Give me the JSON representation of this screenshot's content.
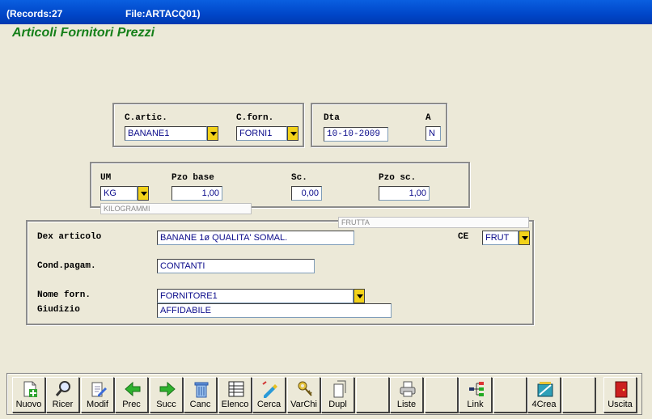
{
  "window": {
    "records": "(Records:27",
    "file": "File:ARTACQ01)"
  },
  "form": {
    "title": "Articoli Fornitori Prezzi",
    "labels": {
      "cartic": "C.artic.",
      "cforn": "C.forn.",
      "dta": "Dta",
      "a": "A",
      "um": "UM",
      "pzo_base": "Pzo base",
      "sc": "Sc.",
      "pzo_sc": "Pzo sc.",
      "dex_articolo": "Dex articolo",
      "ce": "CE",
      "cond_pagam": "Cond.pagam.",
      "nome_forn": "Nome forn.",
      "giudizio": "Giudizio"
    },
    "values": {
      "cartic": "BANANE1",
      "cforn": "FORNI1",
      "dta": "10-10-2009",
      "a": "N",
      "um": "KG",
      "pzo_base": "1,00",
      "sc": "0,00",
      "pzo_sc": "1,00",
      "um_desc": "KILOGRAMMI",
      "frutta": "FRUTTA",
      "dex_articolo": "BANANE 1ø QUALITA' SOMAL.",
      "ce": "FRUT",
      "cond_pagam": "CONTANTI",
      "nome_forn": "FORNITORE1",
      "giudizio": "AFFIDABILE"
    }
  },
  "toolbar": {
    "buttons": [
      {
        "label": "Nuovo",
        "icon": "new-doc-plus-icon"
      },
      {
        "label": "Ricer",
        "icon": "search-magnifier-icon"
      },
      {
        "label": "Modif",
        "icon": "edit-doc-icon"
      },
      {
        "label": "Prec",
        "icon": "arrow-left-icon"
      },
      {
        "label": "Succ",
        "icon": "arrow-right-icon"
      },
      {
        "label": "Canc",
        "icon": "trash-icon"
      },
      {
        "label": "Elenco",
        "icon": "list-table-icon"
      },
      {
        "label": "Cerca",
        "icon": "search-pen-icon"
      },
      {
        "label": "VarChi",
        "icon": "keys-icon"
      },
      {
        "label": "Dupl",
        "icon": "duplicate-icon"
      },
      {
        "label": "",
        "icon": ""
      },
      {
        "label": "Liste",
        "icon": "printer-icon"
      },
      {
        "label": "",
        "icon": ""
      },
      {
        "label": "Link",
        "icon": "tree-link-icon"
      },
      {
        "label": "",
        "icon": ""
      },
      {
        "label": "4Crea",
        "icon": "create-tool-icon"
      },
      {
        "label": "",
        "icon": ""
      },
      {
        "label": "Uscita",
        "icon": "exit-door-icon"
      }
    ]
  }
}
